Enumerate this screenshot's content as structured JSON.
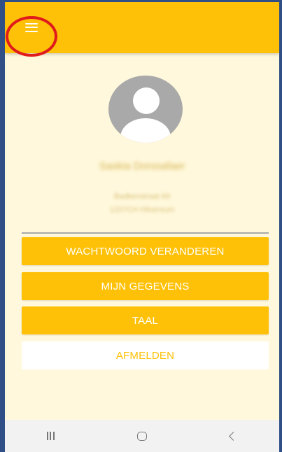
{
  "profile": {
    "name": "Saskia Dorssafaer",
    "address_line1": "Badkenstraat 69",
    "address_line2": "1207CH Hilversum"
  },
  "buttons": {
    "change_password": "WACHTWOORD VERANDEREN",
    "my_details": "MIJN GEGEVENS",
    "language": "TAAL",
    "logout": "AFMELDEN"
  },
  "icons": {
    "menu": "hamburger-menu",
    "avatar": "person-placeholder",
    "recents": "recents-bars",
    "home": "home-rounded-square",
    "back": "chevron-left"
  },
  "colors": {
    "accent": "#ffc107",
    "background": "#fff8dc",
    "highlight_ring": "#e01b1b"
  }
}
